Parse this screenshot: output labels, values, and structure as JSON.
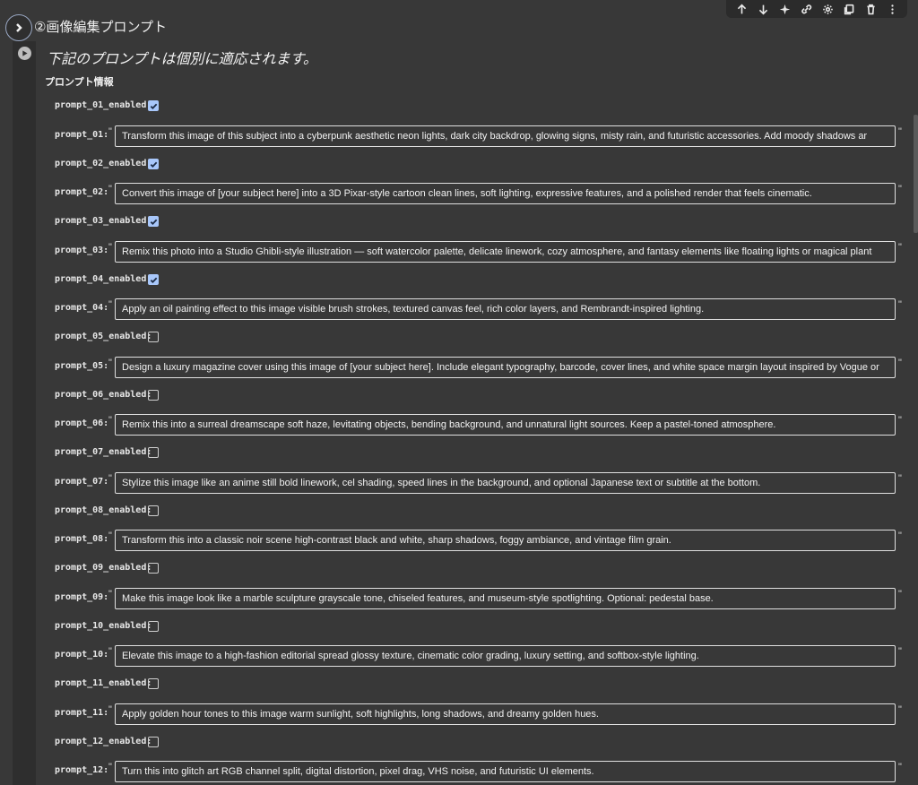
{
  "section": {
    "title": "②画像編集プロンプト"
  },
  "toolbar": {
    "icons": [
      "arrow-up-icon",
      "arrow-down-icon",
      "sparkle-icon",
      "link-icon",
      "gear-icon",
      "mirror-icon",
      "trash-icon",
      "more-vert-icon"
    ]
  },
  "form": {
    "description": "下記のプロンプトは個別に適応されます。",
    "subheading": "プロンプト情報"
  },
  "prompts": [
    {
      "enabled_label": "prompt_01_enabled:",
      "enabled": true,
      "label": "prompt_01:",
      "value": "Transform this image of this subject into a cyberpunk aesthetic neon lights, dark city backdrop, glowing signs, misty rain, and futuristic accessories. Add moody shadows ar"
    },
    {
      "enabled_label": "prompt_02_enabled:",
      "enabled": true,
      "label": "prompt_02:",
      "value": "Convert this image of [your subject here] into a 3D Pixar-style cartoon clean lines, soft lighting, expressive features, and a polished render that feels cinematic."
    },
    {
      "enabled_label": "prompt_03_enabled:",
      "enabled": true,
      "label": "prompt_03:",
      "value": "Remix this photo into a Studio Ghibli-style illustration — soft watercolor palette, delicate linework, cozy atmosphere, and fantasy elements like floating lights or magical plant"
    },
    {
      "enabled_label": "prompt_04_enabled:",
      "enabled": true,
      "label": "prompt_04:",
      "value": "Apply an oil painting effect to this image visible brush strokes, textured canvas feel, rich color layers, and Rembrandt-inspired lighting."
    },
    {
      "enabled_label": "prompt_05_enabled:",
      "enabled": false,
      "label": "prompt_05:",
      "value": "Design a luxury magazine cover using this image of [your subject here]. Include elegant typography, barcode, cover lines, and white space margin layout inspired by Vogue or"
    },
    {
      "enabled_label": "prompt_06_enabled:",
      "enabled": false,
      "label": "prompt_06:",
      "value": "Remix this into a surreal dreamscape soft haze, levitating objects, bending background, and unnatural light sources. Keep a pastel-toned atmosphere."
    },
    {
      "enabled_label": "prompt_07_enabled:",
      "enabled": false,
      "label": "prompt_07:",
      "value": "Stylize this image like an anime still bold linework, cel shading, speed lines in the background, and optional Japanese text or subtitle at the bottom."
    },
    {
      "enabled_label": "prompt_08_enabled:",
      "enabled": false,
      "label": "prompt_08:",
      "value": "Transform this into a classic noir scene high-contrast black and white, sharp shadows, foggy ambiance, and vintage film grain."
    },
    {
      "enabled_label": "prompt_09_enabled:",
      "enabled": false,
      "label": "prompt_09:",
      "value": "Make this image look like a marble sculpture grayscale tone, chiseled features, and museum-style spotlighting. Optional: pedestal base."
    },
    {
      "enabled_label": "prompt_10_enabled:",
      "enabled": false,
      "label": "prompt_10:",
      "value": "Elevate this image to a high-fashion editorial spread glossy texture, cinematic color grading, luxury setting, and softbox-style lighting."
    },
    {
      "enabled_label": "prompt_11_enabled:",
      "enabled": false,
      "label": "prompt_11:",
      "value": "Apply golden hour tones to this image warm sunlight, soft highlights, long shadows, and dreamy golden hues."
    },
    {
      "enabled_label": "prompt_12_enabled:",
      "enabled": false,
      "label": "prompt_12:",
      "value": "Turn this into glitch art RGB channel split, digital distortion, pixel drag, VHS noise, and futuristic UI elements."
    }
  ],
  "colors": {
    "checkbox_checked": "#a8c7fa",
    "background": "#383838"
  }
}
